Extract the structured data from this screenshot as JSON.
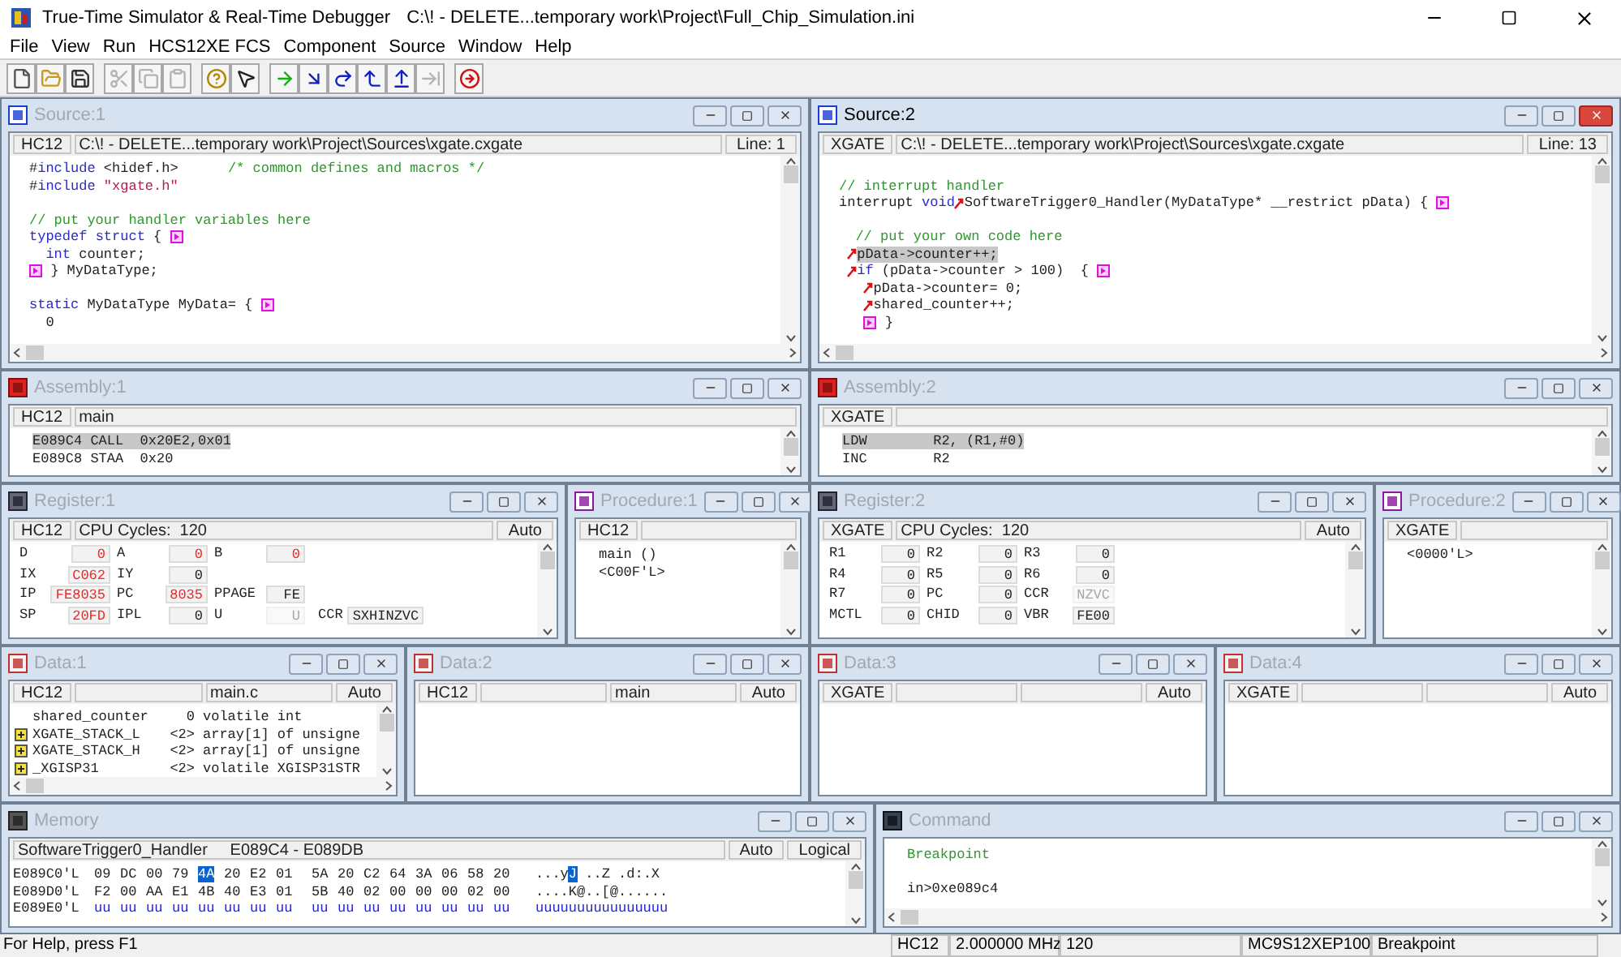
{
  "title_bar": {
    "app_title": "True-Time Simulator & Real-Time Debugger",
    "file_path": "C:\\! - DELETE...temporary work\\Project\\Full_Chip_Simulation.ini"
  },
  "menu": [
    "File",
    "View",
    "Run",
    "HCS12XE FCS",
    "Component",
    "Source",
    "Window",
    "Help"
  ],
  "toolbar": [
    [
      {
        "kind": "new",
        "disabled": false
      },
      {
        "kind": "open",
        "disabled": false
      },
      {
        "kind": "save",
        "disabled": false
      }
    ],
    [
      {
        "kind": "cut",
        "disabled": true
      },
      {
        "kind": "copy",
        "disabled": true
      },
      {
        "kind": "paste",
        "disabled": true
      }
    ],
    [
      {
        "kind": "help",
        "disabled": false
      },
      {
        "kind": "context_help",
        "disabled": false
      }
    ],
    [
      {
        "kind": "start",
        "disabled": false
      },
      {
        "kind": "step_in",
        "disabled": false
      },
      {
        "kind": "step_over",
        "disabled": false
      },
      {
        "kind": "step_out",
        "disabled": false
      },
      {
        "kind": "asm_step",
        "disabled": false
      },
      {
        "kind": "halt",
        "disabled": true
      }
    ],
    [
      {
        "kind": "reset",
        "disabled": false
      }
    ]
  ],
  "rows": [
    [
      {
        "title": "Source:1",
        "kind": "source",
        "active": false,
        "header": [
          {
            "kind": "tag",
            "text": "HC12"
          },
          {
            "kind": "wide",
            "text": "C:\\! - DELETE...temporary work\\Project\\Sources\\xgate.cxgate"
          },
          {
            "kind": "end",
            "text": "Line: 1"
          }
        ],
        "body": {
          "kind": "code",
          "lines": [
            {
              "current": false,
              "segments": [
                {
                  "kind": "plain",
                  "text": "#"
                },
                {
                  "kind": "keyword",
                  "text": "include"
                },
                {
                  "kind": "plain",
                  "text": " <hidef.h>      "
                },
                {
                  "kind": "comment",
                  "text": "/* common defines and macros */"
                }
              ]
            },
            {
              "current": false,
              "segments": [
                {
                  "kind": "plain",
                  "text": "#"
                },
                {
                  "kind": "keyword",
                  "text": "include"
                },
                {
                  "kind": "string",
                  "text": " \"xgate.h\""
                }
              ]
            },
            {
              "current": false
            },
            {
              "current": false,
              "segments": [
                {
                  "kind": "comment",
                  "text": "// put your handler variables here"
                }
              ]
            },
            {
              "current": false,
              "segments": [
                {
                  "kind": "keyword",
                  "text": "typedef"
                },
                {
                  "kind": "keyword",
                  "text": " struct"
                },
                {
                  "kind": "plain",
                  "text": " {"
                },
                {
                  "kind": "indent"
                },
                {
                  "kind": "fold"
                }
              ]
            },
            {
              "current": false,
              "segments": [
                {
                  "kind": "keyword",
                  "text": "  int"
                },
                {
                  "kind": "plain",
                  "text": " counter;"
                }
              ]
            },
            {
              "current": false,
              "segments": [
                {
                  "kind": "fold"
                },
                {
                  "kind": "plain",
                  "text": " } MyDataType;"
                }
              ]
            },
            {
              "current": false
            },
            {
              "current": false,
              "segments": [
                {
                  "kind": "keyword",
                  "text": "static"
                },
                {
                  "kind": "plain",
                  "text": " MyDataType MyData= {"
                },
                {
                  "kind": "indent"
                },
                {
                  "kind": "fold"
                }
              ]
            },
            {
              "current": false,
              "segments": [
                {
                  "kind": "plain",
                  "text": "  0"
                }
              ]
            }
          ]
        }
      },
      {
        "title": "Source:2",
        "kind": "source",
        "active": true,
        "header": [
          {
            "kind": "tag",
            "text": "XGATE"
          },
          {
            "kind": "wide",
            "text": "C:\\! - DELETE...temporary work\\Project\\Sources\\xgate.cxgate"
          },
          {
            "kind": "end",
            "text": "Line: 13"
          }
        ],
        "body": {
          "kind": "code",
          "lines": [
            {
              "current": false
            },
            {
              "current": false,
              "segments": [
                {
                  "kind": "comment",
                  "text": "// interrupt handler"
                }
              ]
            },
            {
              "current": false,
              "segments": [
                {
                  "kind": "plain",
                  "text": "interrupt "
                },
                {
                  "kind": "keyword",
                  "text": "void"
                },
                {
                  "kind": "step_mark"
                },
                {
                  "kind": "plain",
                  "text": "SoftwareTrigger0_Handler(MyDataType* __restrict pData) {"
                },
                {
                  "kind": "indent"
                },
                {
                  "kind": "fold"
                }
              ]
            },
            {
              "current": false
            },
            {
              "current": false,
              "segments": [
                {
                  "kind": "comment",
                  "text": "  // put your own code here"
                }
              ]
            },
            {
              "current": true,
              "segments": [
                {
                  "kind": "indent"
                },
                {
                  "kind": "step_mark"
                },
                {
                  "kind": "plain",
                  "text": "pData->counter++;"
                }
              ]
            },
            {
              "current": false,
              "segments": [
                {
                  "kind": "indent"
                },
                {
                  "kind": "step_mark"
                },
                {
                  "kind": "keyword",
                  "text": "if"
                },
                {
                  "kind": "plain",
                  "text": " (pData->counter > 100)  {"
                },
                {
                  "kind": "indent"
                },
                {
                  "kind": "fold"
                }
              ]
            },
            {
              "current": false,
              "segments": [
                {
                  "kind": "indent"
                },
                {
                  "kind": "indent"
                },
                {
                  "kind": "indent"
                },
                {
                  "kind": "step_mark"
                },
                {
                  "kind": "plain",
                  "text": "pData->counter= 0;"
                }
              ]
            },
            {
              "current": false,
              "segments": [
                {
                  "kind": "indent"
                },
                {
                  "kind": "indent"
                },
                {
                  "kind": "indent"
                },
                {
                  "kind": "step_mark"
                },
                {
                  "kind": "plain",
                  "text": "shared_counter++;"
                }
              ]
            },
            {
              "current": false,
              "segments": [
                {
                  "kind": "indent"
                },
                {
                  "kind": "indent"
                },
                {
                  "kind": "indent"
                },
                {
                  "kind": "fold"
                },
                {
                  "kind": "plain",
                  "text": " }"
                }
              ]
            }
          ]
        }
      }
    ],
    [
      {
        "title": "Assembly:1",
        "kind": "assembly",
        "active": false,
        "header": [
          {
            "kind": "tag",
            "text": "HC12"
          },
          {
            "kind": "wide",
            "text": "main"
          }
        ],
        "body": {
          "kind": "listing",
          "lines": [
            {
              "text": "E089C4 CALL  0x20E2,0x01",
              "current": true
            },
            {
              "text": "E089C8 STAA  0x20",
              "current": false
            }
          ]
        }
      },
      {
        "title": "Assembly:2",
        "kind": "assembly",
        "active": false,
        "header": [
          {
            "kind": "tag",
            "text": "XGATE"
          },
          {
            "kind": "wide"
          }
        ],
        "body": {
          "kind": "listing",
          "lines": [
            {
              "text": "LDW        R2, (R1,#0)",
              "current": true
            },
            {
              "text": "INC        R2",
              "current": false
            }
          ]
        }
      }
    ],
    [
      {
        "title": "Register:1",
        "kind": "register",
        "active": false,
        "header": [
          {
            "kind": "tag",
            "text": "HC12"
          },
          {
            "kind": "wide",
            "text": "CPU Cycles:  120"
          },
          {
            "kind": "end",
            "text": "Auto"
          }
        ],
        "body": {
          "kind": "registers",
          "rows": [
            [
              {
                "name": "D",
                "value": "0",
                "changed": true,
                "disabled": false
              },
              {
                "name": "A",
                "value": "0",
                "changed": true,
                "disabled": false
              },
              {
                "name": "B",
                "value": "0",
                "changed": true,
                "disabled": false
              }
            ],
            [
              {
                "name": "IX",
                "value": "C062",
                "changed": true,
                "disabled": false
              },
              {
                "name": "IY",
                "value": "0",
                "changed": false,
                "disabled": false
              }
            ],
            [
              {
                "name": "IP",
                "value": "FE8035",
                "changed": true,
                "disabled": false
              },
              {
                "name": "PC",
                "value": "8035",
                "changed": true,
                "disabled": false
              },
              {
                "name": "PPAGE",
                "value": "FE",
                "changed": false,
                "disabled": false
              }
            ],
            [
              {
                "name": "SP",
                "value": "20FD",
                "changed": true,
                "disabled": false
              },
              {
                "name": "IPL",
                "value": "0",
                "changed": false,
                "disabled": false
              },
              {
                "name": "U",
                "value": "U",
                "changed": false,
                "disabled": true
              },
              {
                "name": "CCR",
                "value": "SXHINZVC",
                "changed": false,
                "disabled": false
              }
            ]
          ]
        }
      },
      {
        "title": "Procedure:1",
        "kind": "procedure",
        "active": false,
        "header": [
          {
            "kind": "tag",
            "text": "HC12"
          },
          {
            "kind": "wide"
          }
        ],
        "body": {
          "kind": "listing",
          "lines": [
            {
              "text": "main ()",
              "current": false
            },
            {
              "text": "<C00F'L>",
              "current": false
            }
          ]
        }
      },
      {
        "title": "Register:2",
        "kind": "register",
        "active": false,
        "header": [
          {
            "kind": "tag",
            "text": "XGATE"
          },
          {
            "kind": "wide",
            "text": "CPU Cycles:  120"
          },
          {
            "kind": "end",
            "text": "Auto"
          }
        ],
        "body": {
          "kind": "registers",
          "rows": [
            [
              {
                "name": "R1",
                "value": "0",
                "changed": false,
                "disabled": false
              },
              {
                "name": "R2",
                "value": "0",
                "changed": false,
                "disabled": false
              },
              {
                "name": "R3",
                "value": "0",
                "changed": false,
                "disabled": false
              }
            ],
            [
              {
                "name": "R4",
                "value": "0",
                "changed": false,
                "disabled": false
              },
              {
                "name": "R5",
                "value": "0",
                "changed": false,
                "disabled": false
              },
              {
                "name": "R6",
                "value": "0",
                "changed": false,
                "disabled": false
              }
            ],
            [
              {
                "name": "R7",
                "value": "0",
                "changed": false,
                "disabled": false
              },
              {
                "name": "PC",
                "value": "0",
                "changed": false,
                "disabled": false
              },
              {
                "name": "CCR",
                "value": "NZVC",
                "changed": false,
                "disabled": true
              }
            ],
            [
              {
                "name": "MCTL",
                "value": "0",
                "changed": false,
                "disabled": false
              },
              {
                "name": "CHID",
                "value": "0",
                "changed": false,
                "disabled": false
              },
              {
                "name": "VBR",
                "value": "FE00",
                "changed": false,
                "disabled": false
              }
            ]
          ]
        }
      },
      {
        "title": "Procedure:2",
        "kind": "procedure",
        "active": false,
        "header": [
          {
            "kind": "tag",
            "text": "XGATE"
          },
          {
            "kind": "wide"
          }
        ],
        "body": {
          "kind": "listing",
          "lines": [
            {
              "text": "<0000'L>",
              "current": false
            }
          ]
        }
      }
    ],
    [
      {
        "title": "Data:1",
        "kind": "data",
        "active": false,
        "header": [
          {
            "kind": "tag",
            "text": "HC12"
          },
          {
            "kind": "wide"
          },
          {
            "kind": "wide",
            "text": "main.c"
          },
          {
            "kind": "end",
            "text": "Auto"
          }
        ],
        "body": {
          "kind": "variables",
          "rows": [
            {
              "name": "shared_counter",
              "value": "0",
              "type": "volatile int",
              "expandable": false
            },
            {
              "name": "XGATE_STACK_L",
              "value": "<2>",
              "type": "array[1] of unsigne",
              "expandable": true
            },
            {
              "name": "XGATE_STACK_H",
              "value": "<2>",
              "type": "array[1] of unsigne",
              "expandable": true
            },
            {
              "name": "_XGISP31",
              "value": "<2>",
              "type": "volatile XGISP31STR",
              "expandable": true
            }
          ]
        }
      },
      {
        "title": "Data:2",
        "kind": "data",
        "active": false,
        "header": [
          {
            "kind": "tag",
            "text": "HC12"
          },
          {
            "kind": "wide"
          },
          {
            "kind": "wide",
            "text": "main"
          },
          {
            "kind": "end",
            "text": "Auto"
          }
        ],
        "body": {
          "kind": "variables"
        }
      },
      {
        "title": "Data:3",
        "kind": "data",
        "active": false,
        "header": [
          {
            "kind": "tag",
            "text": "XGATE"
          },
          {
            "kind": "wide"
          },
          {
            "kind": "wide"
          },
          {
            "kind": "end",
            "text": "Auto"
          }
        ],
        "body": {
          "kind": "variables"
        }
      },
      {
        "title": "Data:4",
        "kind": "data",
        "active": false,
        "header": [
          {
            "kind": "tag",
            "text": "XGATE"
          },
          {
            "kind": "wide"
          },
          {
            "kind": "wide"
          },
          {
            "kind": "end",
            "text": "Auto"
          }
        ],
        "body": {
          "kind": "variables"
        }
      }
    ],
    [
      {
        "title": "Memory",
        "kind": "memory",
        "active": false,
        "header": [
          {
            "kind": "wide",
            "text": "SoftwareTrigger0_Handler     E089C4 - E089DB"
          },
          {
            "kind": "end",
            "text": "Auto"
          },
          {
            "kind": "end",
            "text": "Logical"
          }
        ],
        "body": {
          "kind": "memory",
          "rows": [
            {
              "address": "E089C0'L",
              "kind": "defined",
              "bytes": [
                {
                  "text": "09",
                  "selected": false
                },
                {
                  "text": "DC",
                  "selected": false
                },
                {
                  "text": "00",
                  "selected": false
                },
                {
                  "text": "79",
                  "selected": false
                },
                {
                  "text": "4A",
                  "selected": true
                },
                {
                  "text": "20",
                  "selected": false
                },
                {
                  "text": "E2",
                  "selected": false
                },
                {
                  "text": "01",
                  "selected": false
                },
                {
                  "text": "5A",
                  "selected": false
                },
                {
                  "text": "20",
                  "selected": false
                },
                {
                  "text": "C2",
                  "selected": false
                },
                {
                  "text": "64",
                  "selected": false
                },
                {
                  "text": "3A",
                  "selected": false
                },
                {
                  "text": "06",
                  "selected": false
                },
                {
                  "text": "58",
                  "selected": false
                },
                {
                  "text": "20",
                  "selected": false
                }
              ],
              "ascii": [
                {
                  "text": "...y",
                  "selected": false
                },
                {
                  "text": "J",
                  "selected": true
                },
                {
                  "text": " ..Z .d:.X",
                  "selected": false
                }
              ]
            },
            {
              "address": "E089D0'L",
              "kind": "defined",
              "bytes": [
                {
                  "text": "F2",
                  "selected": false
                },
                {
                  "text": "00",
                  "selected": false
                },
                {
                  "text": "AA",
                  "selected": false
                },
                {
                  "text": "E1",
                  "selected": false
                },
                {
                  "text": "4B",
                  "selected": false
                },
                {
                  "text": "40",
                  "selected": false
                },
                {
                  "text": "E3",
                  "selected": false
                },
                {
                  "text": "01",
                  "selected": false
                },
                {
                  "text": "5B",
                  "selected": false
                },
                {
                  "text": "40",
                  "selected": false
                },
                {
                  "text": "02",
                  "selected": false
                },
                {
                  "text": "00",
                  "selected": false
                },
                {
                  "text": "00",
                  "selected": false
                },
                {
                  "text": "00",
                  "selected": false
                },
                {
                  "text": "02",
                  "selected": false
                },
                {
                  "text": "00",
                  "selected": false
                }
              ],
              "ascii": [
                {
                  "text": "....K@..[@......",
                  "selected": false
                }
              ]
            },
            {
              "address": "E089E0'L",
              "kind": "undefined",
              "bytes": [
                {
                  "text": "uu",
                  "selected": false
                },
                {
                  "text": "uu",
                  "selected": false
                },
                {
                  "text": "uu",
                  "selected": false
                },
                {
                  "text": "uu",
                  "selected": false
                },
                {
                  "text": "uu",
                  "selected": false
                },
                {
                  "text": "uu",
                  "selected": false
                },
                {
                  "text": "uu",
                  "selected": false
                },
                {
                  "text": "uu",
                  "selected": false
                },
                {
                  "text": "uu",
                  "selected": false
                },
                {
                  "text": "uu",
                  "selected": false
                },
                {
                  "text": "uu",
                  "selected": false
                },
                {
                  "text": "uu",
                  "selected": false
                },
                {
                  "text": "uu",
                  "selected": false
                },
                {
                  "text": "uu",
                  "selected": false
                },
                {
                  "text": "uu",
                  "selected": false
                },
                {
                  "text": "uu",
                  "selected": false
                }
              ],
              "ascii": [
                {
                  "text": "uuuuuuuuuuuuuuuu",
                  "selected": false
                }
              ]
            }
          ]
        }
      },
      {
        "title": "Command",
        "kind": "command",
        "active": false,
        "body": {
          "kind": "command",
          "lines": [
            {
              "kind": "output",
              "text": "Breakpoint"
            },
            {
              "kind": "prompt",
              "text": "in>0xe089c4"
            }
          ]
        }
      }
    ]
  ],
  "status_bar": {
    "help": "For Help, press F1",
    "fields": [
      "HC12",
      "2.000000 MHz",
      "120",
      "MC9S12XEP100",
      "Breakpoint"
    ]
  }
}
